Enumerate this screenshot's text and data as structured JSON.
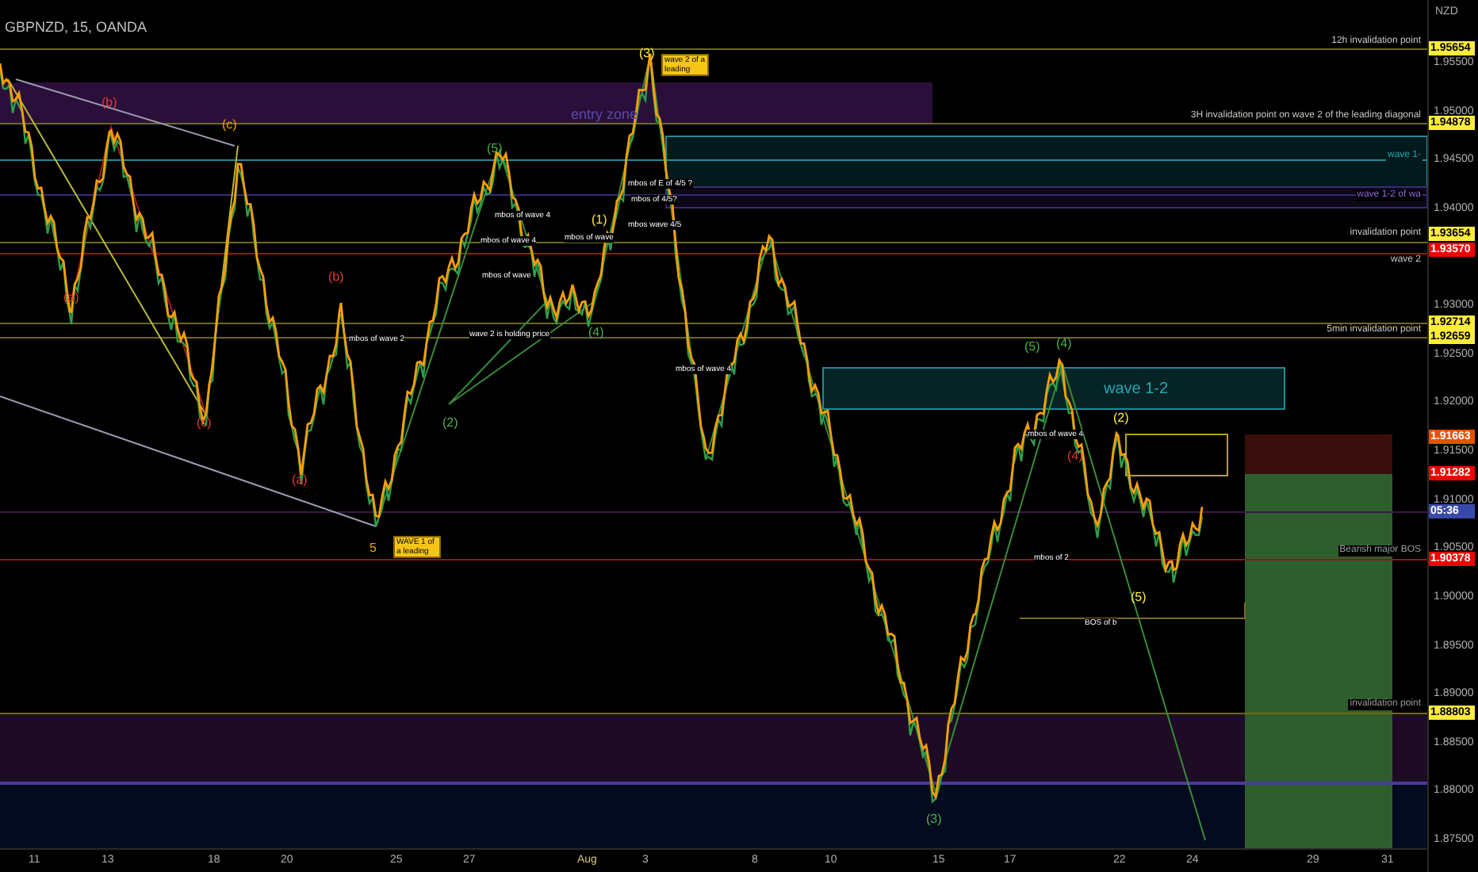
{
  "header": {
    "title": "GBPNZD, 15, OANDA"
  },
  "price_axis": {
    "currency": "NZD",
    "ticks": [
      "1.95500",
      "1.95000",
      "1.94500",
      "1.94000",
      "1.93000",
      "1.92500",
      "1.92000",
      "1.91500",
      "1.91000",
      "1.90500",
      "1.90000",
      "1.89500",
      "1.89000",
      "1.88500",
      "1.88000",
      "1.87500"
    ],
    "markers": [
      {
        "text": "1.95654",
        "color": "#ffeb3b"
      },
      {
        "text": "1.94878",
        "color": "#ffeb3b"
      },
      {
        "text": "1.93654",
        "color": "#ffeb3b"
      },
      {
        "text": "1.93570",
        "color": "#f20000"
      },
      {
        "text": "1.92714",
        "color": "#ffeb3b"
      },
      {
        "text": "1.92659",
        "color": "#ffeb3b"
      },
      {
        "text": "1.91663",
        "color": "#e65100"
      },
      {
        "text": "1.91282",
        "color": "#f20000"
      },
      {
        "text": "05:36",
        "color": "#3949ab"
      },
      {
        "text": "1.90378",
        "color": "#f20000"
      },
      {
        "text": "1.88803",
        "color": "#ffeb3b"
      }
    ]
  },
  "levels": [
    {
      "label": "12h invalidation point",
      "kind": "level"
    },
    {
      "label": "3H invalidation point on wave 2 of the leading diagonal",
      "kind": "level"
    },
    {
      "label": "wave 1-",
      "kind": "teal"
    },
    {
      "label": "wave 1-2 of wa",
      "kind": "violet"
    },
    {
      "label": "invalidation point",
      "kind": "level"
    },
    {
      "label": "wave 2",
      "kind": "level"
    },
    {
      "label": "5min invalidation point",
      "kind": "level"
    },
    {
      "label": "Bearish major BOS",
      "kind": "bos"
    },
    {
      "label": "invalidation point",
      "kind": "bos"
    }
  ],
  "zones": [
    {
      "label": "entry zone"
    },
    {
      "label": "wave 1-2"
    }
  ],
  "annotations": [
    {
      "text": "wave 2 of a leading",
      "kind": "boxed"
    },
    {
      "text": "WAVE 1 of a leading",
      "kind": "boxed"
    },
    {
      "text": "mbos of E of 4/5 ?",
      "kind": "label"
    },
    {
      "text": "mbos of 4/5?",
      "kind": "label"
    },
    {
      "text": "mbos wave 4/5",
      "kind": "label"
    },
    {
      "text": "mbos of wave 4",
      "kind": "label"
    },
    {
      "text": "mbos of wave 4",
      "kind": "label"
    },
    {
      "text": "mbos of wave",
      "kind": "label"
    },
    {
      "text": "mbos of wave",
      "kind": "label"
    },
    {
      "text": "mbos of wave 2",
      "kind": "label"
    },
    {
      "text": "wave 2 is holding price",
      "kind": "label"
    },
    {
      "text": "mbos of wave 4",
      "kind": "label"
    },
    {
      "text": "mbos of wave 4",
      "kind": "label"
    },
    {
      "text": "mbos of 2",
      "kind": "label"
    },
    {
      "text": "BOS of b",
      "kind": "label"
    }
  ],
  "wave_labels": [
    {
      "text": "(b)",
      "color": "#e53935"
    },
    {
      "text": "(a)",
      "color": "#e53935"
    },
    {
      "text": "(c)",
      "color": "#ff9800"
    },
    {
      "text": "(b)",
      "color": "#e53935"
    },
    {
      "text": "(a)",
      "color": "#e53935"
    },
    {
      "text": "(c)",
      "color": "#e53935"
    },
    {
      "text": "5",
      "color": "#ff9800"
    },
    {
      "text": "(5)",
      "color": "#4caf50"
    },
    {
      "text": "(2)",
      "color": "#4caf50"
    },
    {
      "text": "(4)",
      "color": "#4caf50"
    },
    {
      "text": "(3)",
      "color": "#ffeb3b"
    },
    {
      "text": "(1)",
      "color": "#ffeb3b"
    },
    {
      "text": "(5)",
      "color": "#4caf50"
    },
    {
      "text": "(4)",
      "color": "#4caf50"
    },
    {
      "text": "(2)",
      "color": "#ffeb3b"
    },
    {
      "text": "(3)",
      "color": "#4caf50"
    },
    {
      "text": "(5)",
      "color": "#ffeb3b"
    },
    {
      "text": "(4)",
      "color": "#e53935"
    }
  ],
  "date_axis": {
    "labels": [
      {
        "text": "11",
        "kind": "day"
      },
      {
        "text": "13",
        "kind": "day"
      },
      {
        "text": "18",
        "kind": "day"
      },
      {
        "text": "20",
        "kind": "day"
      },
      {
        "text": "25",
        "kind": "day"
      },
      {
        "text": "27",
        "kind": "day"
      },
      {
        "text": "Aug",
        "kind": "month"
      },
      {
        "text": "3",
        "kind": "day"
      },
      {
        "text": "8",
        "kind": "day"
      },
      {
        "text": "10",
        "kind": "day"
      },
      {
        "text": "15",
        "kind": "day"
      },
      {
        "text": "17",
        "kind": "day"
      },
      {
        "text": "22",
        "kind": "day"
      },
      {
        "text": "24",
        "kind": "day"
      },
      {
        "text": "29",
        "kind": "day"
      },
      {
        "text": "31",
        "kind": "day"
      }
    ]
  }
}
